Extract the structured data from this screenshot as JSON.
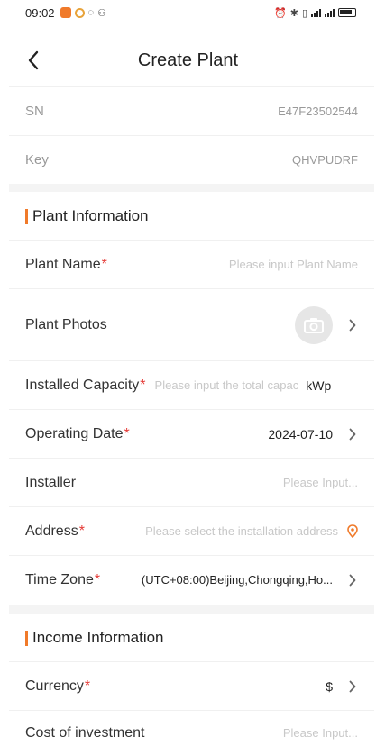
{
  "status": {
    "time": "09:02"
  },
  "header": {
    "title": "Create Plant",
    "back_icon": "chevron-left-icon"
  },
  "device": {
    "sn_label": "SN",
    "sn_value": "E47F23502544",
    "key_label": "Key",
    "key_value": "QHVPUDRF"
  },
  "plant_info": {
    "section_title": "Plant Information",
    "plant_name_label": "Plant Name",
    "plant_name_placeholder": "Please input Plant Name",
    "plant_photos_label": "Plant Photos",
    "capacity_label": "Installed Capacity",
    "capacity_placeholder": "Please input the total capac",
    "capacity_unit": "kWp",
    "operating_date_label": "Operating Date",
    "operating_date_value": "2024-07-10",
    "installer_label": "Installer",
    "installer_placeholder": "Please Input...",
    "address_label": "Address",
    "address_placeholder": "Please select the installation address",
    "timezone_label": "Time Zone",
    "timezone_value": "(UTC+08:00)Beijing,Chongqing,Ho..."
  },
  "income_info": {
    "section_title": "Income Information",
    "currency_label": "Currency",
    "currency_value": "$",
    "investment_label": "Cost of investment",
    "investment_placeholder": "Please Input..."
  },
  "required_mark": "*",
  "colors": {
    "accent": "#f07a2a",
    "required": "#e53935",
    "placeholder": "#c8c8c8"
  }
}
